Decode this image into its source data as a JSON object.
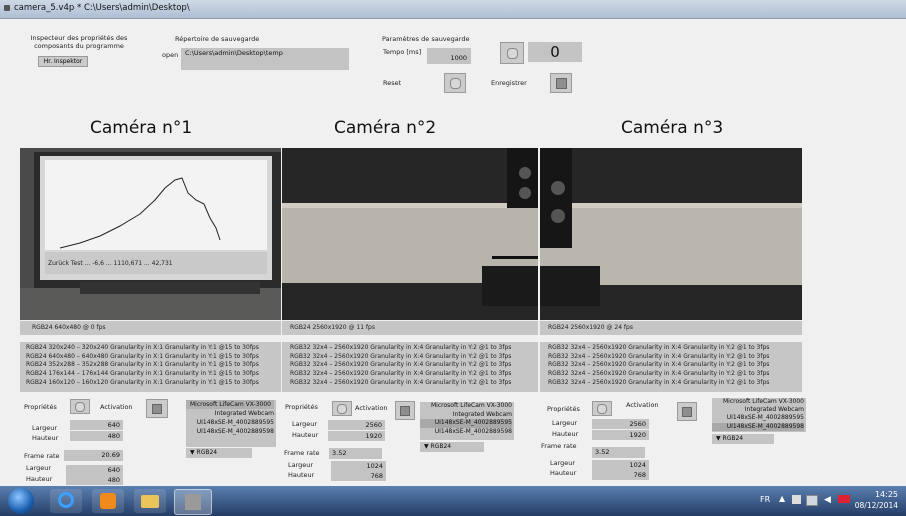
{
  "window": {
    "title": "camera_5.v4p * C:\\Users\\admin\\Desktop\\"
  },
  "inspector": {
    "label": "Inspecteur des propriétés des composants du programme",
    "button": "Hr. Inspektor"
  },
  "save_dir": {
    "label": "Répertoire de sauvegarde",
    "open_label": "open",
    "path": "C:\\Users\\admin\\Desktop\\temp"
  },
  "save_params": {
    "label": "Paramètres de sauvegarde",
    "tempo_label": "Tempo [ms]",
    "tempo_value": "1000",
    "counter": "0",
    "reset_label": "Reset",
    "record_label": "Enregistrer"
  },
  "cameras": [
    {
      "title": "Caméra n°1",
      "screen_readout": "Zurück   Test ...   -6,6 ...   1110,671 ...   42,731",
      "caption": "RGB24 640x480 @ 0 fps",
      "formats": [
        "RGB24 320x240 – 320x240 Granularity in X:1 Granularity in Y:1 @15 to 30fps",
        "RGB24 640x480 – 640x480 Granularity in X:1 Granularity in Y:1 @15 to 30fps",
        "RGB24 352x288 – 352x288 Granularity in X:1 Granularity in Y:1 @15 to 30fps",
        "RGB24 176x144 – 176x144 Granularity in X:1 Granularity in Y:1 @15 to 30fps",
        "RGB24 160x120 – 160x120 Granularity in X:1 Granularity in Y:1 @15 to 30fps"
      ],
      "props_label": "Propriétés",
      "activation_label": "Activation",
      "largeur_label": "Largeur",
      "largeur": "640",
      "hauteur_label": "Hauteur",
      "hauteur": "480",
      "framerate_label": "Frame rate",
      "framerate": "20.69",
      "out_largeur_label": "Largeur",
      "out_largeur": "640",
      "out_hauteur_label": "Hauteur",
      "out_hauteur": "480",
      "devices": [
        "Microsoft LifeCam VX-3000",
        "Integrated Webcam",
        "UI148xSE-M_4002889595",
        "UI148xSE-M_4002889598"
      ],
      "format": "RGB24"
    },
    {
      "title": "Caméra n°2",
      "caption": "RGB24 2560x1920 @ 11 fps",
      "formats": [
        "RGB32 32x4 – 2560x1920 Granularity in X:4 Granularity in Y:2 @1 to 3fps",
        "RGB32 32x4 – 2560x1920 Granularity in X:4 Granularity in Y:2 @1 to 3fps",
        "RGB32 32x4 – 2560x1920 Granularity in X:4 Granularity in Y:2 @1 to 3fps",
        "RGB32 32x4 – 2560x1920 Granularity in X:4 Granularity in Y:2 @1 to 3fps",
        "RGB32 32x4 – 2560x1920 Granularity in X:4 Granularity in Y:2 @1 to 3fps"
      ],
      "props_label": "Propriétés",
      "activation_label": "Activation",
      "largeur_label": "Largeur",
      "largeur": "2560",
      "hauteur_label": "Hauteur",
      "hauteur": "1920",
      "framerate_label": "Frame rate",
      "framerate": "3.52",
      "out_largeur_label": "Largeur",
      "out_largeur": "1024",
      "out_hauteur_label": "Hauteur",
      "out_hauteur": "768",
      "devices": [
        "Microsoft LifeCam VX-3000",
        "Integrated Webcam",
        "UI148xSE-M_4002889595",
        "UI148xSE-M_4002889598"
      ],
      "format": "RGB24"
    },
    {
      "title": "Caméra n°3",
      "caption": "RGB24 2560x1920 @ 24 fps",
      "formats": [
        "RGB32 32x4 – 2560x1920 Granularity in X:4 Granularity in Y:2 @1 to 3fps",
        "RGB32 32x4 – 2560x1920 Granularity in X:4 Granularity in Y:2 @1 to 3fps",
        "RGB32 32x4 – 2560x1920 Granularity in X:4 Granularity in Y:2 @1 to 3fps",
        "RGB32 32x4 – 2560x1920 Granularity in X:4 Granularity in Y:2 @1 to 3fps",
        "RGB32 32x4 – 2560x1920 Granularity in X:4 Granularity in Y:2 @1 to 3fps"
      ],
      "props_label": "Propriétés",
      "activation_label": "Activation",
      "largeur_label": "Largeur",
      "largeur": "2560",
      "hauteur_label": "Hauteur",
      "hauteur": "1920",
      "framerate_label": "Frame rate",
      "framerate": "3.52",
      "out_largeur_label": "Largeur",
      "out_largeur": "1024",
      "out_hauteur_label": "Hauteur",
      "out_hauteur": "768",
      "devices": [
        "Microsoft LifeCam VX-3000",
        "Integrated Webcam",
        "UI148xSE-M_4002889595",
        "UI148xSE-M_4002889598"
      ],
      "format": "RGB24"
    }
  ],
  "taskbar": {
    "lang": "FR",
    "time": "14:25",
    "date": "08/12/2014",
    "icons": [
      "start-orb-icon",
      "internet-explorer-icon",
      "media-player-icon",
      "file-explorer-icon",
      "vvvv-icon"
    ]
  },
  "colors": {
    "patch_bg": "#f0f0f0",
    "field": "#c3c3c3",
    "taskbar": "#2f4d7c"
  }
}
